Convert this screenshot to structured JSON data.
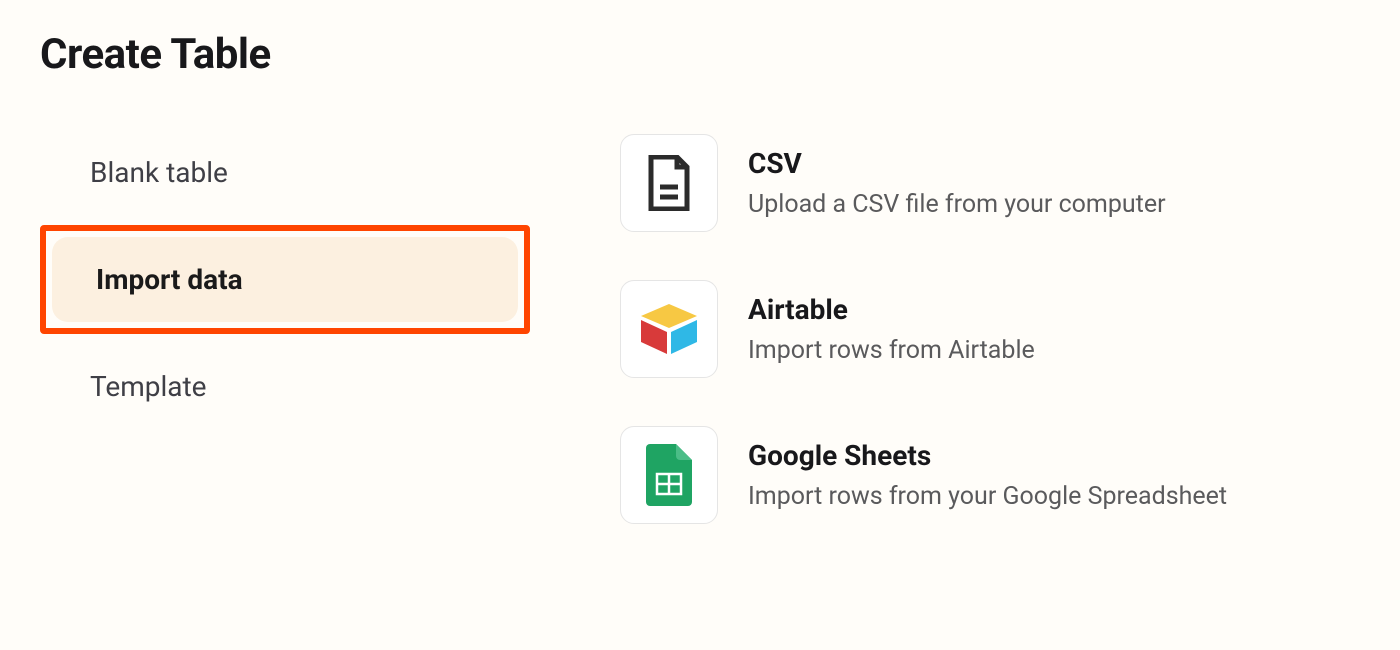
{
  "header": {
    "title": "Create Table"
  },
  "sidebar": {
    "items": [
      {
        "label": "Blank table",
        "selected": false
      },
      {
        "label": "Import data",
        "selected": true
      },
      {
        "label": "Template",
        "selected": false
      }
    ]
  },
  "import_options": [
    {
      "icon": "file-csv-icon",
      "title": "CSV",
      "description": "Upload a CSV file from your computer"
    },
    {
      "icon": "airtable-icon",
      "title": "Airtable",
      "description": "Import rows from Airtable"
    },
    {
      "icon": "google-sheets-icon",
      "title": "Google Sheets",
      "description": "Import rows from your Google Spreadsheet"
    }
  ]
}
